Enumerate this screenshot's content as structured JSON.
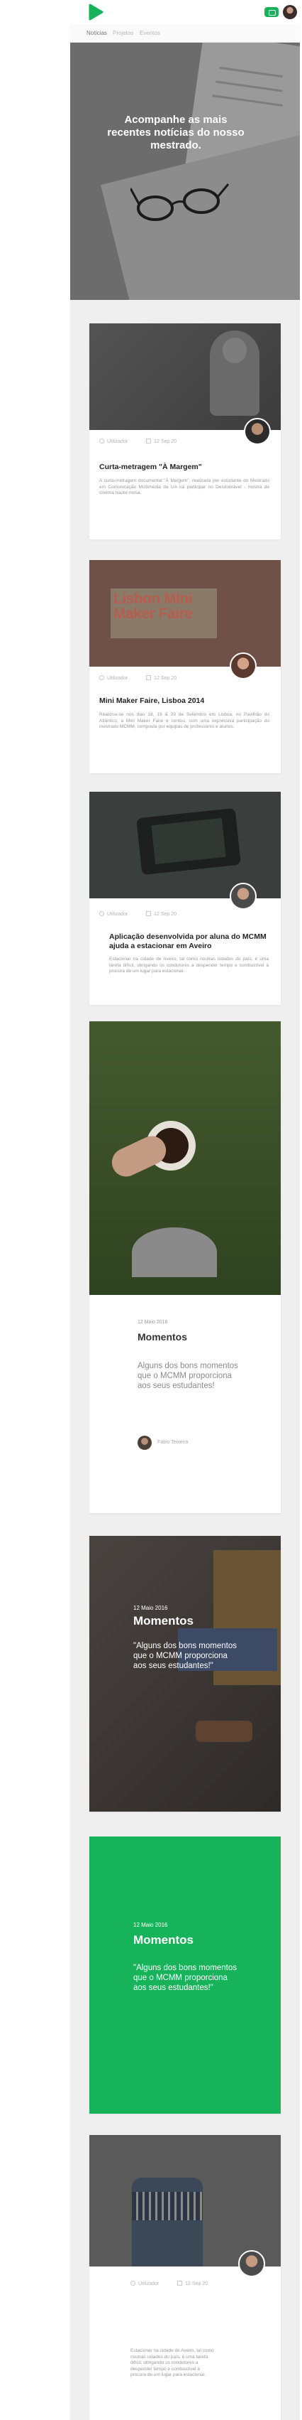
{
  "nav": {
    "tabs": [
      "Notícias",
      "Projetos",
      "Eventos"
    ],
    "active_tab": "Notícias",
    "logo_icon": "play-logo-icon",
    "chat_icon": "chat-icon"
  },
  "hero": {
    "title": "Acompanhe as mais recentes notícias do nosso mestrado."
  },
  "cards": [
    {
      "author": "Utilizador",
      "date": "12 Sep 20",
      "title": "Curta-metragem \"À Margem\"",
      "excerpt": "A curta-metragem documental \"À Margem\", realizada por estudante do Mestrado em Comunicação Multimédia da UA irá participar no Desdobrável - mostra de cinema trauto-mosa."
    },
    {
      "author": "Utilizador",
      "date": "12 Sep 20",
      "title": "Mini Maker Faire, Lisboa 2014",
      "excerpt": "Realizou-se nos dias 18, 19 & 20 de Setembro em Lisboa, no Pavilhão do Atlântico, a Mini Maker Faire e contou, com uma expressiva participação do mestrado MCMM, composta por equipas de professores e alunos.",
      "image_text_1": "Lisbon Mini",
      "image_text_2": "Maker Faire"
    },
    {
      "author": "Utilizador",
      "date": "12 Sep 20",
      "title": "Aplicação desenvolvida por aluna do MCMM ajuda a estacionar em Aveiro",
      "excerpt": "Estacionar na cidade de Aveiro, tal como noutras cidades do país, é uma tarefa difícil, obrigando os condutores a despender tempo e combustível à procura de um lugar para estacionar."
    }
  ],
  "quote_card": {
    "date": "12 Maio 2016",
    "title": "Momentos",
    "quote": "Alguns dos bons momentos que o MCMM proporciona aos seus estudantes!",
    "author": "Fábio Teixeira"
  },
  "photo_quote_card": {
    "date": "12 Maio 2016",
    "title": "Momentos",
    "quote": "\"Alguns dos bons momentos que o MCMM proporciona aos seus estudantes!\""
  },
  "green_card": {
    "date": "12 Maio 2016",
    "title": "Momentos",
    "quote": "\"Alguns dos bons momentos que o MCMM proporciona aos seus estudantes!\""
  },
  "last_card": {
    "author": "Utilizador",
    "date": "12 Sep 20",
    "excerpt": "Estacionar na cidade de Aveiro, tal como noutras cidades do país, é uma tarefa difícil, obrigando os condutores a despender tempo e combustível à procura de um lugar para estacionar."
  },
  "colors": {
    "accent": "#17b35a",
    "page_bg": "#efefef"
  }
}
